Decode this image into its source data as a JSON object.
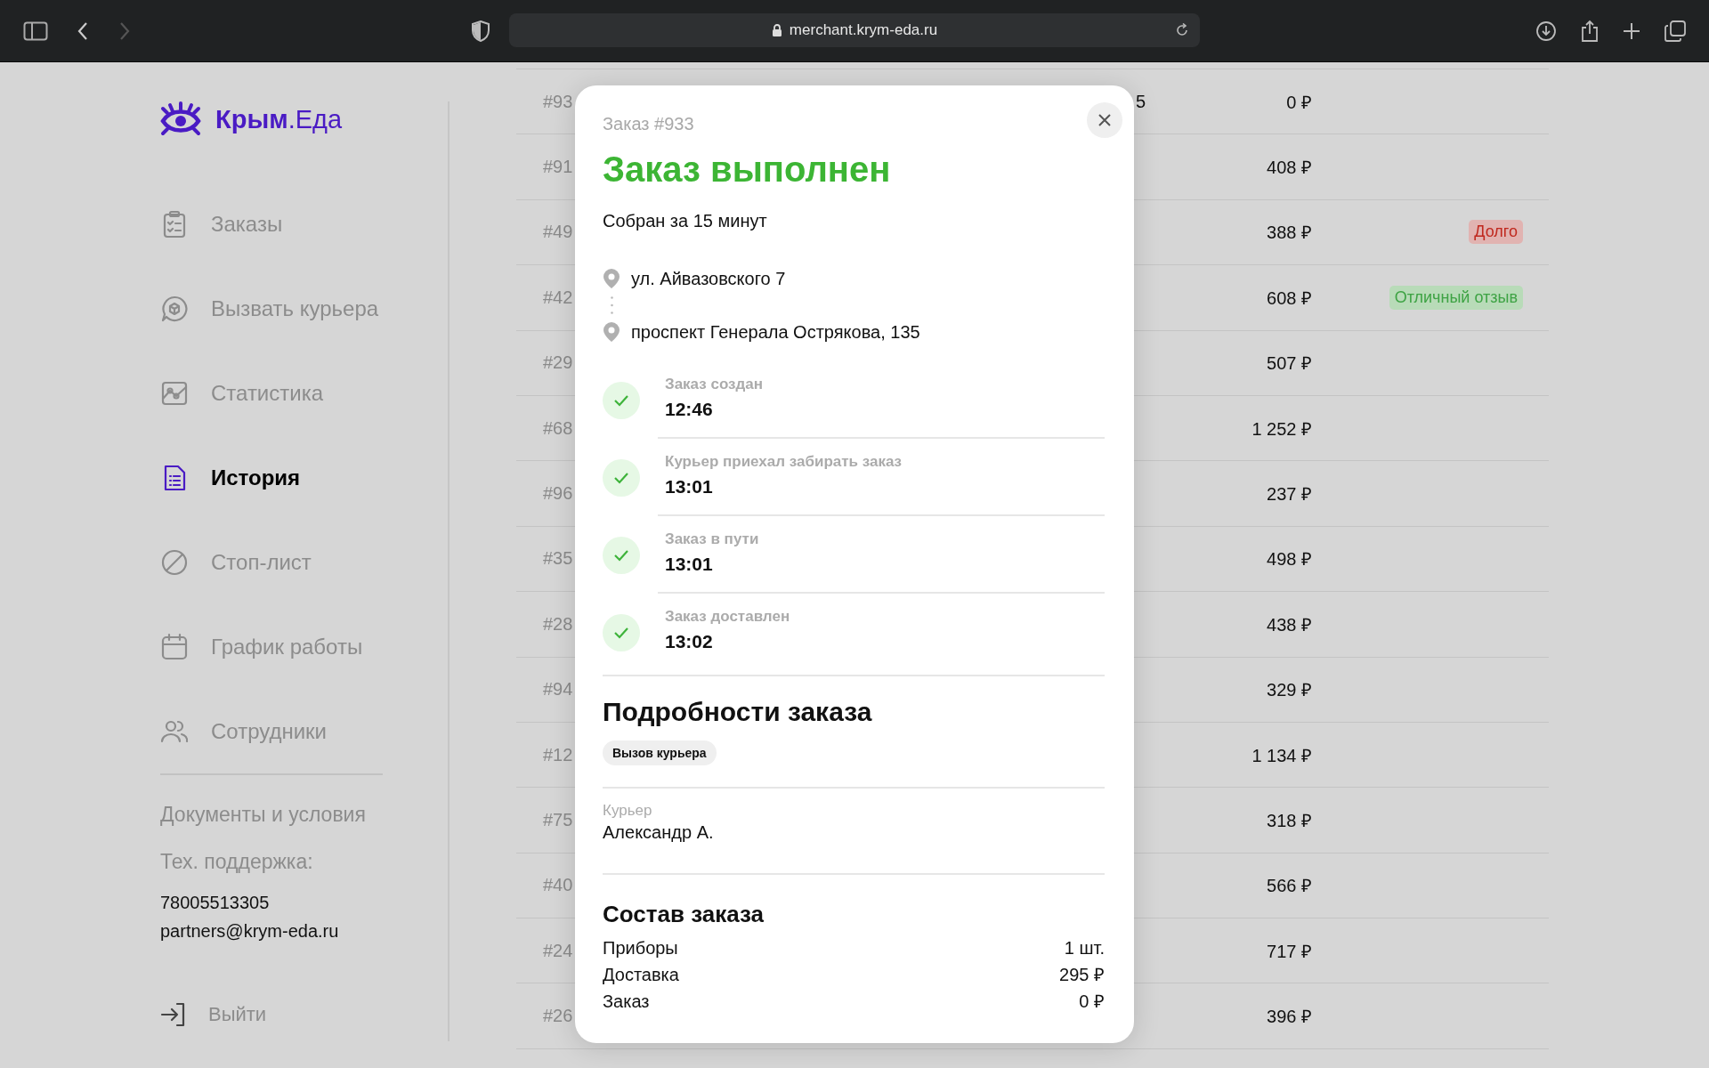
{
  "browser": {
    "url": "merchant.krym-eda.ru",
    "back_enabled": true,
    "forward_enabled": false
  },
  "sidebar": {
    "logo": "**Крым**.Еда",
    "nav": [
      {
        "label": "Заказы",
        "selected": false
      },
      {
        "label": "Вызвать курьера",
        "selected": false
      },
      {
        "label": "Статистика",
        "selected": false
      },
      {
        "label": "История",
        "selected": true
      },
      {
        "label": "Стоп-лист",
        "selected": false
      },
      {
        "label": "График работы",
        "selected": false
      },
      {
        "label": "Сотрудники",
        "selected": false
      }
    ],
    "documents": "Документы и условия",
    "support_label": "Тех. поддержка:",
    "phone": "78005513305",
    "email": "partners@krym-eda.ru",
    "logout": "Выйти"
  },
  "table": {
    "rows": [
      {
        "column_1": "#93",
        "column_3": "5",
        "column_4": "0 ₽"
      },
      {
        "column_1": "#91",
        "column_4": "408 ₽"
      },
      {
        "column_1": "#49",
        "column_4": "388 ₽",
        "tag": {
          "text": "Долго",
          "kind": "warning"
        }
      },
      {
        "column_1": "#42",
        "column_4": "608 ₽",
        "tag": {
          "text": "Отличный отзыв",
          "kind": "positive"
        }
      },
      {
        "column_1": "#29",
        "column_4": "507 ₽"
      },
      {
        "column_1": "#68",
        "column_4": "1 252 ₽"
      },
      {
        "column_1": "#96",
        "column_4": "237 ₽"
      },
      {
        "column_1": "#35",
        "column_4": "498 ₽"
      },
      {
        "column_1": "#28",
        "column_4": "438 ₽"
      },
      {
        "column_1": "#94",
        "column_4": "329 ₽"
      },
      {
        "column_1": "#12",
        "column_4": "1 134 ₽"
      },
      {
        "column_1": "#75",
        "column_4": "318 ₽"
      },
      {
        "column_1": "#40",
        "column_4": "566 ₽"
      },
      {
        "column_1": "#24",
        "column_4": "717 ₽"
      },
      {
        "column_1": "#26",
        "column_4": "396 ₽"
      }
    ]
  },
  "modal": {
    "order": "Заказ #933",
    "status": "Заказ выполнен",
    "assembled": "Собран за 15 минут",
    "addresses": [
      "ул. Айвазовского 7",
      "проспект Генерала Острякова, 135"
    ],
    "steps": [
      {
        "label": "Заказ создан",
        "time": "12:46",
        "done": true
      },
      {
        "label": "Курьер приехал забирать заказ",
        "time": "13:01",
        "done": true
      },
      {
        "label": "Заказ в пути",
        "time": "13:01",
        "done": true
      },
      {
        "label": "Заказ доставлен",
        "time": "13:02",
        "done": true
      }
    ],
    "details_title": "Подробности заказа",
    "chip": "Вызов курьера",
    "courier_label": "Курьер",
    "courier": "Александр А.",
    "composition_title": "Состав заказа",
    "items": [
      {
        "name": "Приборы",
        "value": "1 шт."
      },
      {
        "name": "Доставка",
        "value": "295 ₽"
      },
      {
        "name": "Заказ",
        "value": "0 ₽"
      }
    ]
  }
}
